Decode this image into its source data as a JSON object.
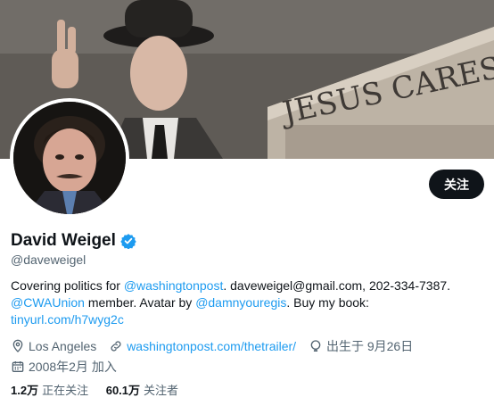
{
  "profile": {
    "follow_label": "关注",
    "name": "David Weigel",
    "handle": "@daveweigel",
    "bio": {
      "t1": "Covering politics for ",
      "m1": "@washingtonpost",
      "t2": ". daveweigel@gmail.com, 202-334-7387.",
      "m2": "@CWAUnion",
      "t3": " member. Avatar by ",
      "m3": "@damnyouregis",
      "t4": ". Buy my book:",
      "url": "tinyurl.com/h7wyg2c"
    },
    "location": "Los Angeles",
    "website": "washingtonpost.com/thetrailer/",
    "birthday": "出生于 9月26日",
    "joined": "2008年2月 加入",
    "following_count": "1.2万",
    "following_label": "正在关注",
    "followers_count": "60.1万",
    "followers_label": "关注者",
    "banner_sign": "JESUS CARES"
  },
  "colors": {
    "accent": "#1d9bf0",
    "text": "#0f1419",
    "muted": "#536471"
  }
}
